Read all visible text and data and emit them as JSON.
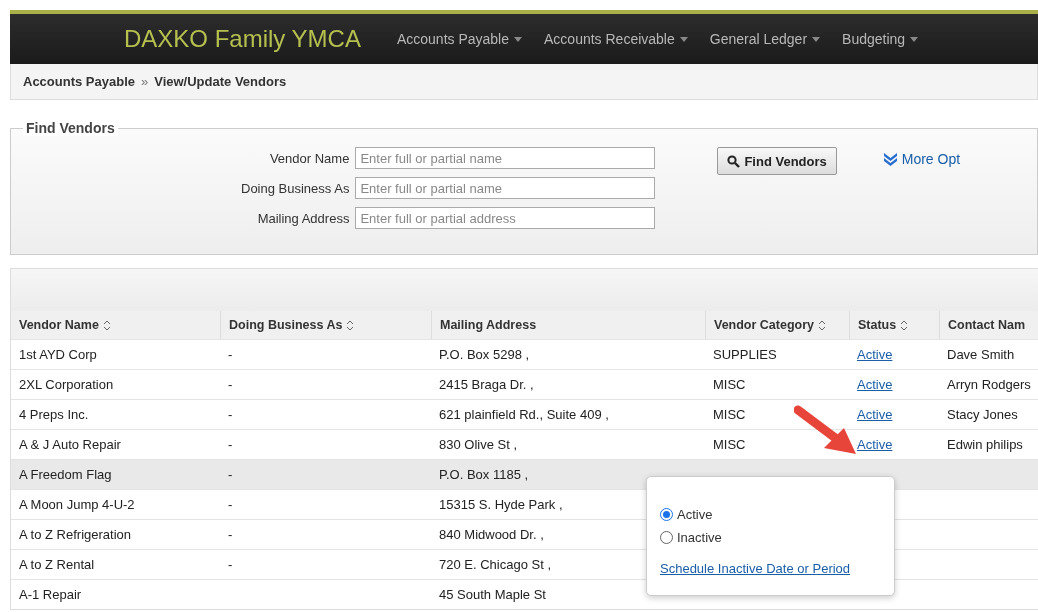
{
  "header": {
    "brand": "DAXKO Family YMCA",
    "menu": [
      {
        "label": "Accounts Payable"
      },
      {
        "label": "Accounts Receivable"
      },
      {
        "label": "General Ledger"
      },
      {
        "label": "Budgeting"
      }
    ]
  },
  "breadcrumb": [
    "Accounts Payable",
    "»",
    "View/Update Vendors"
  ],
  "find_vendors": {
    "title": "Find Vendors",
    "fields": [
      {
        "label": "Vendor Name",
        "placeholder": "Enter full or partial name"
      },
      {
        "label": "Doing Business As",
        "placeholder": "Enter full or partial name"
      },
      {
        "label": "Mailing Address",
        "placeholder": "Enter full or partial address"
      }
    ],
    "button": "Find Vendors",
    "more_options": "More Opt"
  },
  "table": {
    "columns": [
      {
        "label": "Vendor Name",
        "sortable": true
      },
      {
        "label": "Doing Business As",
        "sortable": true
      },
      {
        "label": "Mailing Address",
        "sortable": false
      },
      {
        "label": "Vendor Category",
        "sortable": true
      },
      {
        "label": "Status",
        "sortable": true
      },
      {
        "label": "Contact Nam",
        "sortable": false
      }
    ],
    "rows": [
      {
        "highlighted": false,
        "cells": [
          "1st AYD Corp",
          "-",
          "P.O. Box 5298 ,",
          "SUPPLIES",
          "Active",
          "Dave Smith"
        ]
      },
      {
        "highlighted": false,
        "cells": [
          "2XL Corporation",
          "-",
          "2415 Braga Dr. ,",
          "MISC",
          "Active",
          "Arryn Rodgers"
        ]
      },
      {
        "highlighted": false,
        "cells": [
          "4 Preps Inc.",
          "-",
          "621 plainfield Rd., Suite 409 ,",
          "MISC",
          "Active",
          "Stacy Jones"
        ]
      },
      {
        "highlighted": false,
        "cells": [
          "A & J Auto Repair",
          "-",
          "830 Olive St ,",
          "MISC",
          "Active",
          "Edwin philips"
        ]
      },
      {
        "highlighted": true,
        "cells": [
          "A Freedom Flag",
          "-",
          "P.O. Box 1185 ,",
          null,
          null,
          null
        ]
      },
      {
        "highlighted": false,
        "cells": [
          "A Moon Jump 4-U-2",
          "-",
          "15315 S. Hyde Park ,",
          null,
          null,
          null
        ]
      },
      {
        "highlighted": false,
        "cells": [
          "A to Z Refrigeration",
          "-",
          "840 Midwood Dr. ,",
          null,
          null,
          null
        ]
      },
      {
        "highlighted": false,
        "cells": [
          "A to Z Rental",
          "-",
          "720 E. Chicago St ,",
          null,
          null,
          null
        ]
      },
      {
        "highlighted": false,
        "cells": [
          "A-1 Repair",
          "",
          "45 South Maple St",
          null,
          null,
          null
        ]
      }
    ]
  },
  "status_popup": {
    "options": [
      {
        "label": "Active",
        "selected": true
      },
      {
        "label": "Inactive",
        "selected": false
      }
    ],
    "link": "Schedule Inactive Date or Period"
  }
}
